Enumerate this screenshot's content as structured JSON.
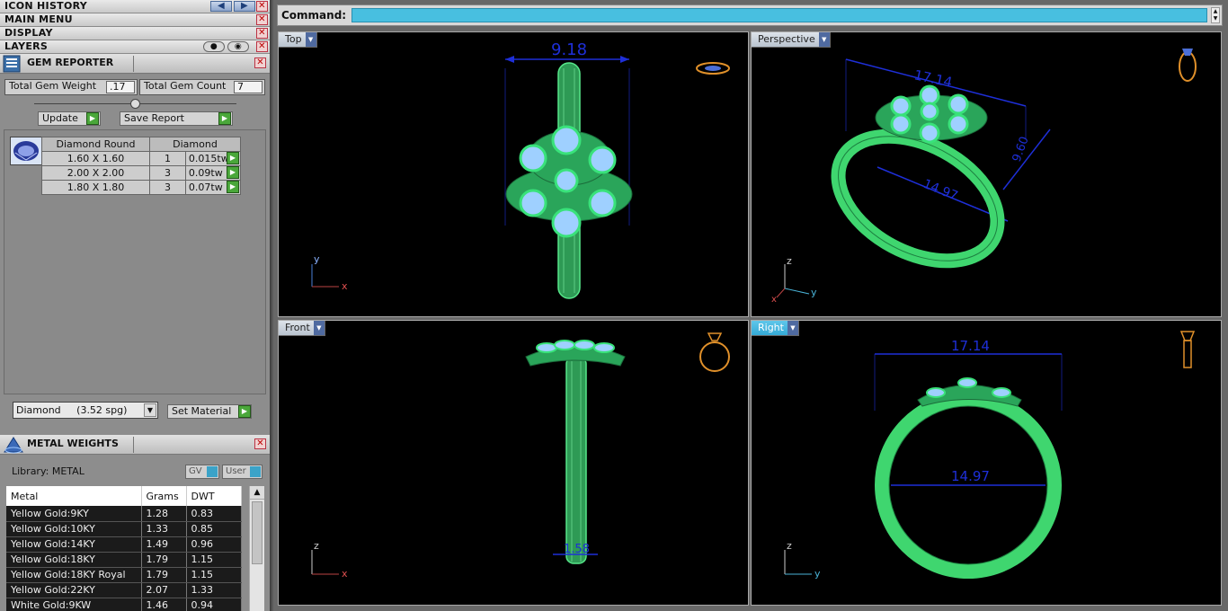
{
  "left_panel": {
    "bars": {
      "icon_history": "ICON HISTORY",
      "main_menu": "MAIN MENU",
      "display": "DISPLAY",
      "layers": "LAYERS"
    },
    "gem_reporter": {
      "title": "GEM REPORTER",
      "total_gem_weight_label": "Total Gem Weight",
      "total_gem_weight_value": ".17",
      "total_gem_count_label": "Total Gem Count",
      "total_gem_count_value": "7",
      "update_label": "Update",
      "save_report_label": "Save Report",
      "table": {
        "headers": [
          "Diamond Round",
          "Diamond"
        ],
        "rows": [
          {
            "size": "1.60 X 1.60",
            "count": "1",
            "weight": "0.015tw"
          },
          {
            "size": "2.00 X 2.00",
            "count": "3",
            "weight": "0.09tw"
          },
          {
            "size": "1.80 X 1.80",
            "count": "3",
            "weight": "0.07tw"
          }
        ]
      },
      "material_select": "Diamond     (3.52 spg)",
      "set_material_label": "Set Material"
    },
    "metal_weights": {
      "title": "METAL WEIGHTS",
      "library_label": "Library: METAL",
      "gv_label": "GV",
      "user_label": "User",
      "headers": [
        "Metal",
        "Grams",
        "DWT"
      ],
      "rows": [
        {
          "metal": "Yellow Gold:9KY",
          "grams": "1.28",
          "dwt": "0.83"
        },
        {
          "metal": "Yellow Gold:10KY",
          "grams": "1.33",
          "dwt": "0.85"
        },
        {
          "metal": "Yellow Gold:14KY",
          "grams": "1.49",
          "dwt": "0.96"
        },
        {
          "metal": "Yellow Gold:18KY",
          "grams": "1.79",
          "dwt": "1.15"
        },
        {
          "metal": "Yellow Gold:18KY Royal",
          "grams": "1.79",
          "dwt": "1.15"
        },
        {
          "metal": "Yellow Gold:22KY",
          "grams": "2.07",
          "dwt": "1.33"
        },
        {
          "metal": "White Gold:9KW",
          "grams": "1.46",
          "dwt": "0.94"
        }
      ]
    }
  },
  "command": {
    "label": "Command:",
    "value": ""
  },
  "viewports": {
    "top": {
      "label": "Top",
      "dimension": "9.18"
    },
    "perspective": {
      "label": "Perspective",
      "dim_a": "17.14",
      "dim_b": "14.97",
      "dim_c": "9.60"
    },
    "front": {
      "label": "Front",
      "dimension": "1.58"
    },
    "right": {
      "label": "Right",
      "dim_a": "17.14",
      "dim_b": "14.97"
    }
  },
  "colors": {
    "metal": "#3fd66f",
    "gem": "#9fd0ff",
    "dimension": "#1e2fd8",
    "accent": "#48bfe0"
  }
}
